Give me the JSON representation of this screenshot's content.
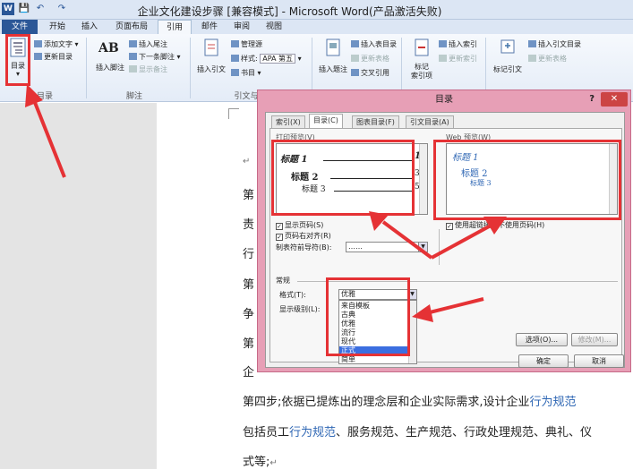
{
  "window": {
    "title": "企业文化建设步骤 [兼容模式] - Microsoft Word(产品激活失败)"
  },
  "qat": {
    "word_icon": "W",
    "save_icon": "💾",
    "undo_icon": "↶",
    "redo_icon": "↷"
  },
  "tabs": {
    "file": "文件",
    "items": [
      "开始",
      "插入",
      "页面布局",
      "引用",
      "邮件",
      "审阅",
      "视图"
    ]
  },
  "ribbon": {
    "toc": {
      "label": "目录",
      "group": "目录",
      "add_text": "添加文字",
      "update_toc": "更新目录"
    },
    "footnotes": {
      "insert_footnote": "插入脚注",
      "insert_endnote": "插入尾注",
      "next_footnote": "下一条脚注",
      "show_notes": "显示备注",
      "group": "脚注",
      "ab_glyph": "AB"
    },
    "citations": {
      "insert_citation": "插入引文",
      "manage_sources": "管理源",
      "style_label": "样式:",
      "style_value": "APA 第五",
      "bibliography": "书目",
      "group": "引文与书目"
    },
    "captions": {
      "insert_caption": "插入题注",
      "insert_table_of_figures": "插入表目录",
      "update_table": "更新表格",
      "cross_reference": "交叉引用"
    },
    "index": {
      "mark_entry": "标记\n索引项",
      "insert_index": "插入索引",
      "update_index": "更新索引"
    },
    "toa": {
      "mark_citation": "标记引文",
      "insert_toa": "插入引文目录",
      "update_table": "更新表格"
    }
  },
  "document": {
    "lines": [
      {
        "text": "第"
      },
      {
        "text": "责"
      },
      {
        "text": "行"
      },
      {
        "text": "第"
      },
      {
        "text": "争"
      },
      {
        "text": "第"
      },
      {
        "text": "企"
      }
    ],
    "para4_prefix": "第四步;依据已提炼出的理念层和企业实际需求,设计企业",
    "para4_link": "行为规范",
    "para5_prefix": "包括员工",
    "para5_link": "行为规范",
    "para5_suffix": "、服务规范、生产规范、行政处理规范、典礼、仪",
    "para6": "式等;",
    "return_mark": "↵"
  },
  "dialog": {
    "title": "目录",
    "help": "?",
    "close_icon": "✕",
    "tabs": [
      "索引(X)",
      "目录(C)",
      "图表目录(F)",
      "引文目录(A)"
    ],
    "print_preview_label": "打印预览(V)",
    "web_preview_label": "Web 预览(W)",
    "print_preview": [
      {
        "text": "标题 1",
        "page": "1"
      },
      {
        "text": "标题 2",
        "page": "3"
      },
      {
        "text": "标题 3",
        "page": "5"
      }
    ],
    "web_preview": [
      "标题 1",
      "标题 2",
      "标题 3"
    ],
    "show_page_numbers": "显示页码(S)",
    "right_align": "页码右对齐(R)",
    "tab_leader_label": "制表符前导符(B):",
    "tab_leader_value": "……",
    "use_hyperlinks": "使用超链接而不使用页码(H)",
    "general_label": "常规",
    "format_label": "格式(T):",
    "format_value": "优雅",
    "levels_label": "显示级别(L):",
    "format_options": [
      "来自模板",
      "古典",
      "优雅",
      "流行",
      "现代",
      "正式",
      "简单"
    ],
    "selected_option": "正式",
    "options_button": "选项(O)...",
    "modify_button": "修改(M)...",
    "ok_button": "确定",
    "cancel_button": "取消"
  }
}
